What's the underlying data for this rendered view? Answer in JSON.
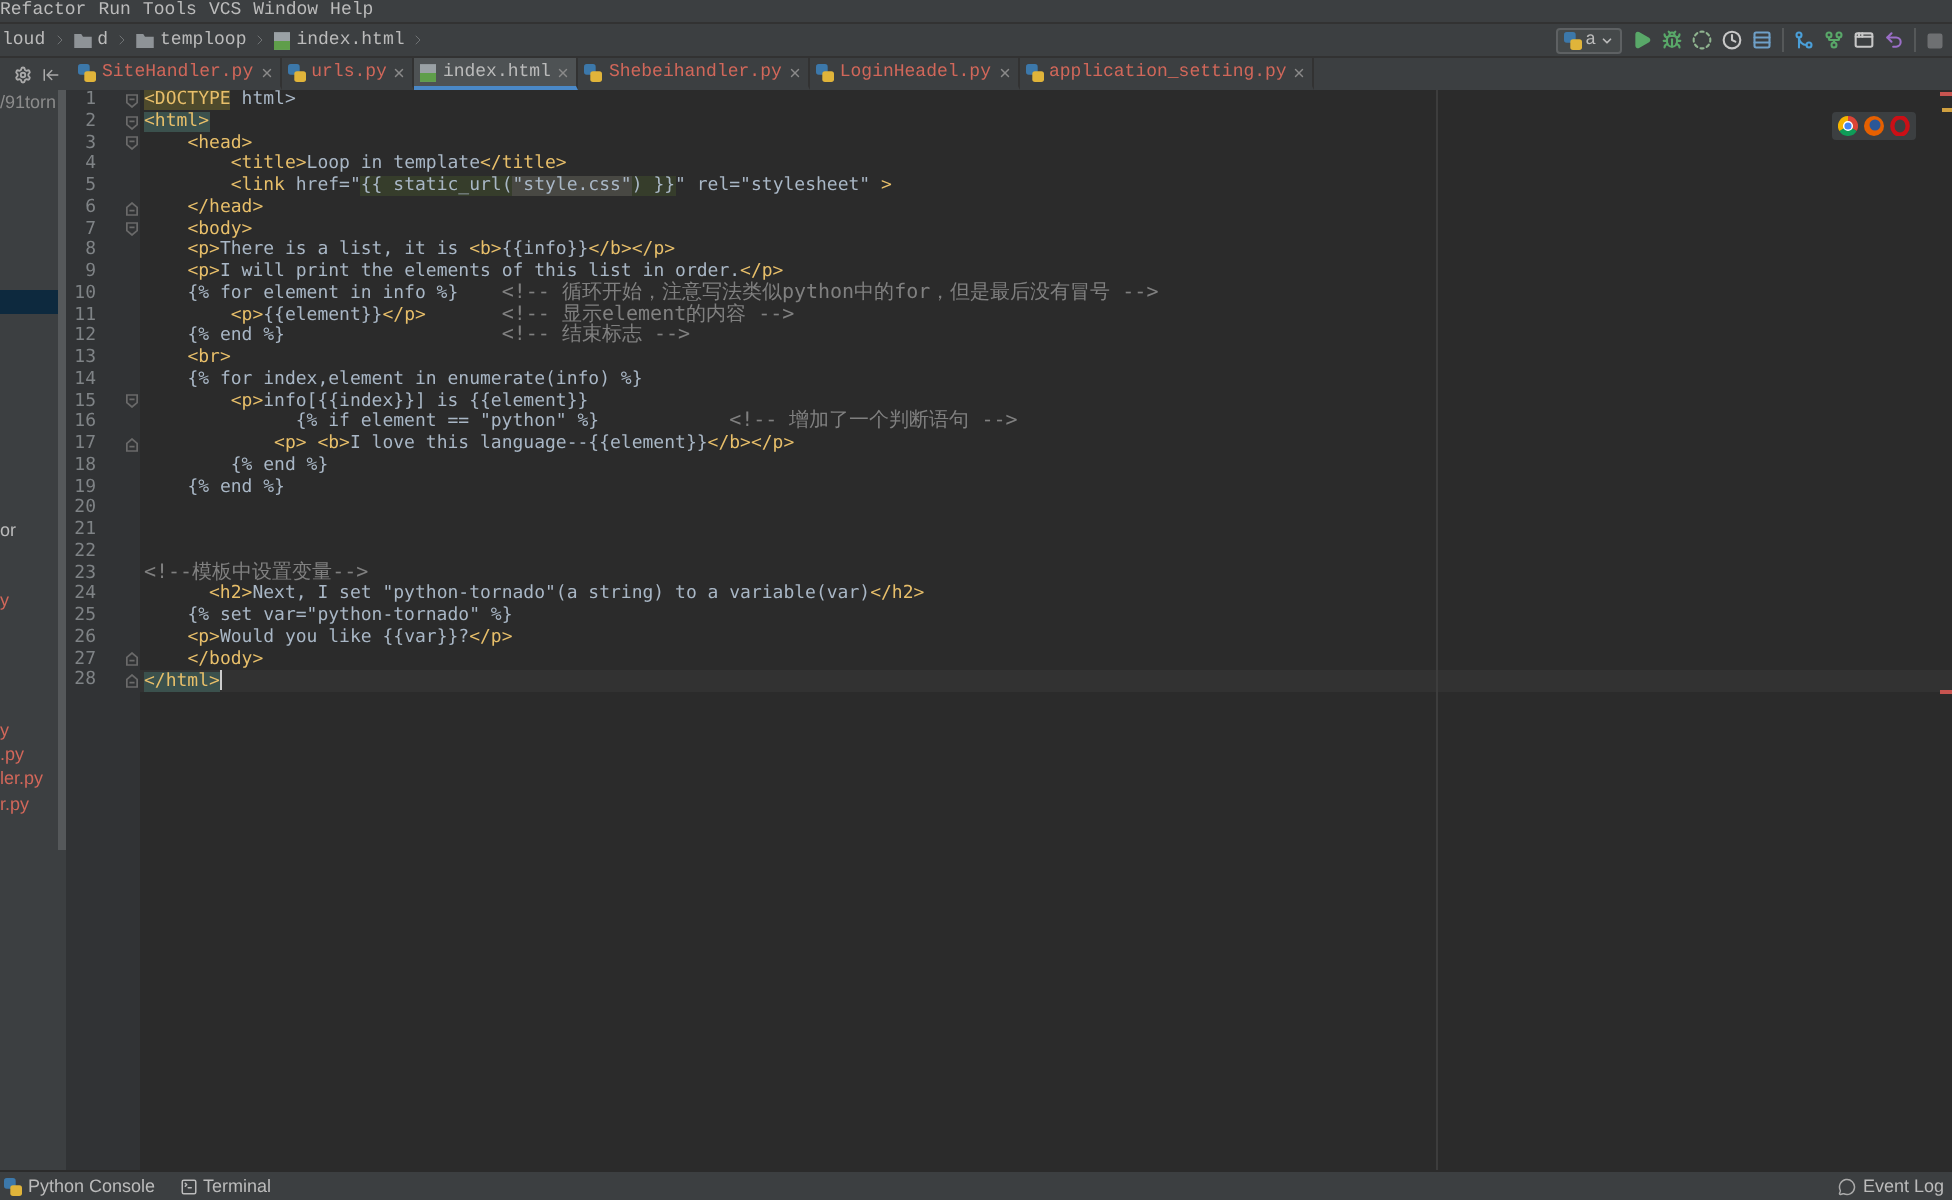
{
  "menu_bar": {
    "items": [
      "Refactor",
      "Run",
      "Tools",
      "VCS",
      "Window",
      "Help"
    ]
  },
  "breadcrumbs": [
    {
      "kind": "plain",
      "label": "loud"
    },
    {
      "kind": "folder",
      "label": "d"
    },
    {
      "kind": "folder",
      "label": "temploop"
    },
    {
      "kind": "html",
      "label": "index.html"
    }
  ],
  "run_configuration": {
    "label": "a"
  },
  "tabs": [
    {
      "label": "SiteHandler.py",
      "kind": "python",
      "color": "#d1675a",
      "selected": false
    },
    {
      "label": "urls.py",
      "kind": "python",
      "color": "#d1675a",
      "selected": false
    },
    {
      "label": "index.html",
      "kind": "html",
      "color": "#bbbbbb",
      "selected": true
    },
    {
      "label": "Shebeihandler.py",
      "kind": "python",
      "color": "#d1675a",
      "selected": false
    },
    {
      "label": "LoginHeadel.py",
      "kind": "python",
      "color": "#d1675a",
      "selected": false
    },
    {
      "label": "application_setting.py",
      "kind": "python",
      "color": "#d1675a",
      "selected": false
    }
  ],
  "project_tree": {
    "rows": [
      {
        "text": "/91torn",
        "color": "#8c8c8c",
        "selected": false
      },
      {
        "selected": true
      },
      {
        "text": "or",
        "color": "#bbbbbb",
        "selected": false
      },
      {
        "text": "y",
        "color": "#d1675a",
        "selected": false
      },
      {
        "text": "y",
        "color": "#d1675a",
        "selected": false
      },
      {
        "text": ".py",
        "color": "#d1675a",
        "selected": false
      },
      {
        "text": "ler.py",
        "color": "#d1675a",
        "selected": false
      },
      {
        "text": "r.py",
        "color": "#d1675a",
        "selected": false
      }
    ]
  },
  "editor": {
    "lines": [
      {
        "number": "1",
        "fold_marker": {
          "kind": "start"
        },
        "tokens": [
          {
            "kind": "warning",
            "text": "<DOCTYPE"
          },
          {
            "kind": "text",
            "text": " html>"
          }
        ]
      },
      {
        "number": "2",
        "fold_marker": {
          "kind": "start"
        },
        "tokens": [
          {
            "kind": "matched",
            "text": "<html>"
          }
        ]
      },
      {
        "number": "3",
        "fold_marker": {
          "kind": "start"
        },
        "tokens": [
          {
            "kind": "tag",
            "text": "    <head>"
          }
        ]
      },
      {
        "number": "4",
        "tokens": [
          {
            "kind": "tag",
            "text": "        <title>"
          },
          {
            "kind": "text",
            "text": "Loop in template"
          },
          {
            "kind": "tag",
            "text": "</title>"
          }
        ]
      },
      {
        "number": "5",
        "tokens": [
          {
            "kind": "tag",
            "text": "        <link"
          },
          {
            "kind": "text",
            "text": " href=\""
          },
          {
            "kind": "injection",
            "text": "{{ static_url("
          },
          {
            "kind": "string",
            "text": "\"style.css\""
          },
          {
            "kind": "injection",
            "text": ") }}"
          },
          {
            "kind": "text",
            "text": "\" rel=\"stylesheet\" "
          },
          {
            "kind": "tag",
            "text": ">"
          }
        ]
      },
      {
        "number": "6",
        "fold_marker": {
          "kind": "end"
        },
        "tokens": [
          {
            "kind": "tag",
            "text": "    </head>"
          }
        ]
      },
      {
        "number": "7",
        "fold_marker": {
          "kind": "start"
        },
        "tokens": [
          {
            "kind": "tag",
            "text": "    <body>"
          }
        ]
      },
      {
        "number": "8",
        "tokens": [
          {
            "kind": "tag",
            "text": "    <p>"
          },
          {
            "kind": "text",
            "text": "There is a list, it is "
          },
          {
            "kind": "tag",
            "text": "<b>"
          },
          {
            "kind": "text",
            "text": "{{info}}"
          },
          {
            "kind": "tag",
            "text": "</b></p>"
          }
        ]
      },
      {
        "number": "9",
        "tokens": [
          {
            "kind": "tag",
            "text": "    <p>"
          },
          {
            "kind": "text",
            "text": "I will print the elements of this list in order."
          },
          {
            "kind": "tag",
            "text": "</p>"
          }
        ]
      },
      {
        "number": "10",
        "tokens": [
          {
            "kind": "text",
            "text": "    {% for element in info %}    "
          },
          {
            "kind": "comment",
            "text": "<!-- 循环开始，注意写法类似python中的for，但是最后没有冒号 -->"
          }
        ]
      },
      {
        "number": "11",
        "tokens": [
          {
            "kind": "tag",
            "text": "        <p>"
          },
          {
            "kind": "text",
            "text": "{{element}}"
          },
          {
            "kind": "tag",
            "text": "</p>       "
          },
          {
            "kind": "comment",
            "text": "<!-- 显示element的内容 -->"
          }
        ]
      },
      {
        "number": "12",
        "tokens": [
          {
            "kind": "text",
            "text": "    {% end %}                    "
          },
          {
            "kind": "comment",
            "text": "<!-- 结束标志 -->"
          }
        ]
      },
      {
        "number": "13",
        "tokens": [
          {
            "kind": "tag",
            "text": "    <br>"
          }
        ]
      },
      {
        "number": "14",
        "tokens": [
          {
            "kind": "text",
            "text": "    {% for index,element in enumerate(info) %}"
          }
        ]
      },
      {
        "number": "15",
        "fold_marker": {
          "kind": "start"
        },
        "tokens": [
          {
            "kind": "tag",
            "text": "        <p>"
          },
          {
            "kind": "text",
            "text": "info[{{index}}] is {{element}}"
          }
        ]
      },
      {
        "number": "16",
        "tokens": [
          {
            "kind": "text",
            "text": "              {% if element == \"python\" %}            "
          },
          {
            "kind": "comment",
            "text": "<!-- 增加了一个判断语句 -->"
          }
        ]
      },
      {
        "number": "17",
        "fold_marker": {
          "kind": "end"
        },
        "tokens": [
          {
            "kind": "tag",
            "text": "            <p> <b>"
          },
          {
            "kind": "text",
            "text": "I love this language--{{element}}"
          },
          {
            "kind": "tag",
            "text": "</b></p>"
          }
        ]
      },
      {
        "number": "18",
        "tokens": [
          {
            "kind": "text",
            "text": "        {% end %}"
          }
        ]
      },
      {
        "number": "19",
        "tokens": [
          {
            "kind": "text",
            "text": "    {% end %}"
          }
        ]
      },
      {
        "number": "20"
      },
      {
        "number": "21"
      },
      {
        "number": "22"
      },
      {
        "number": "23",
        "tokens": [
          {
            "kind": "comment",
            "text": "<!--模板中设置变量-->"
          }
        ]
      },
      {
        "number": "24",
        "tokens": [
          {
            "kind": "tag",
            "text": "      <h2>"
          },
          {
            "kind": "text",
            "text": "Next, I set \"python-tornado\"(a string) to a variable(var)"
          },
          {
            "kind": "tag",
            "text": "</h2>"
          }
        ]
      },
      {
        "number": "25",
        "tokens": [
          {
            "kind": "text",
            "text": "    {% set var=\"python-tornado\" %}"
          }
        ]
      },
      {
        "number": "26",
        "tokens": [
          {
            "kind": "tag",
            "text": "    <p>"
          },
          {
            "kind": "text",
            "text": "Would you like {{var}}?"
          },
          {
            "kind": "tag",
            "text": "</p>"
          }
        ]
      },
      {
        "number": "27",
        "fold_marker": {
          "kind": "end"
        },
        "tokens": [
          {
            "kind": "tag",
            "text": "    </body>"
          }
        ]
      },
      {
        "number": "28",
        "fold_marker": {
          "kind": "end"
        },
        "current": true,
        "tokens": [
          {
            "kind": "matched",
            "text": "</html>"
          }
        ]
      }
    ]
  },
  "error_stripe": [
    {
      "kind": "error"
    },
    {
      "kind": "warning"
    },
    {
      "kind": "error"
    }
  ],
  "status_bar": {
    "tool_windows": [
      {
        "kind": "python",
        "label": "Python Console"
      },
      {
        "kind": "terminal",
        "label": "Terminal"
      }
    ],
    "event_log": "Event Log"
  }
}
